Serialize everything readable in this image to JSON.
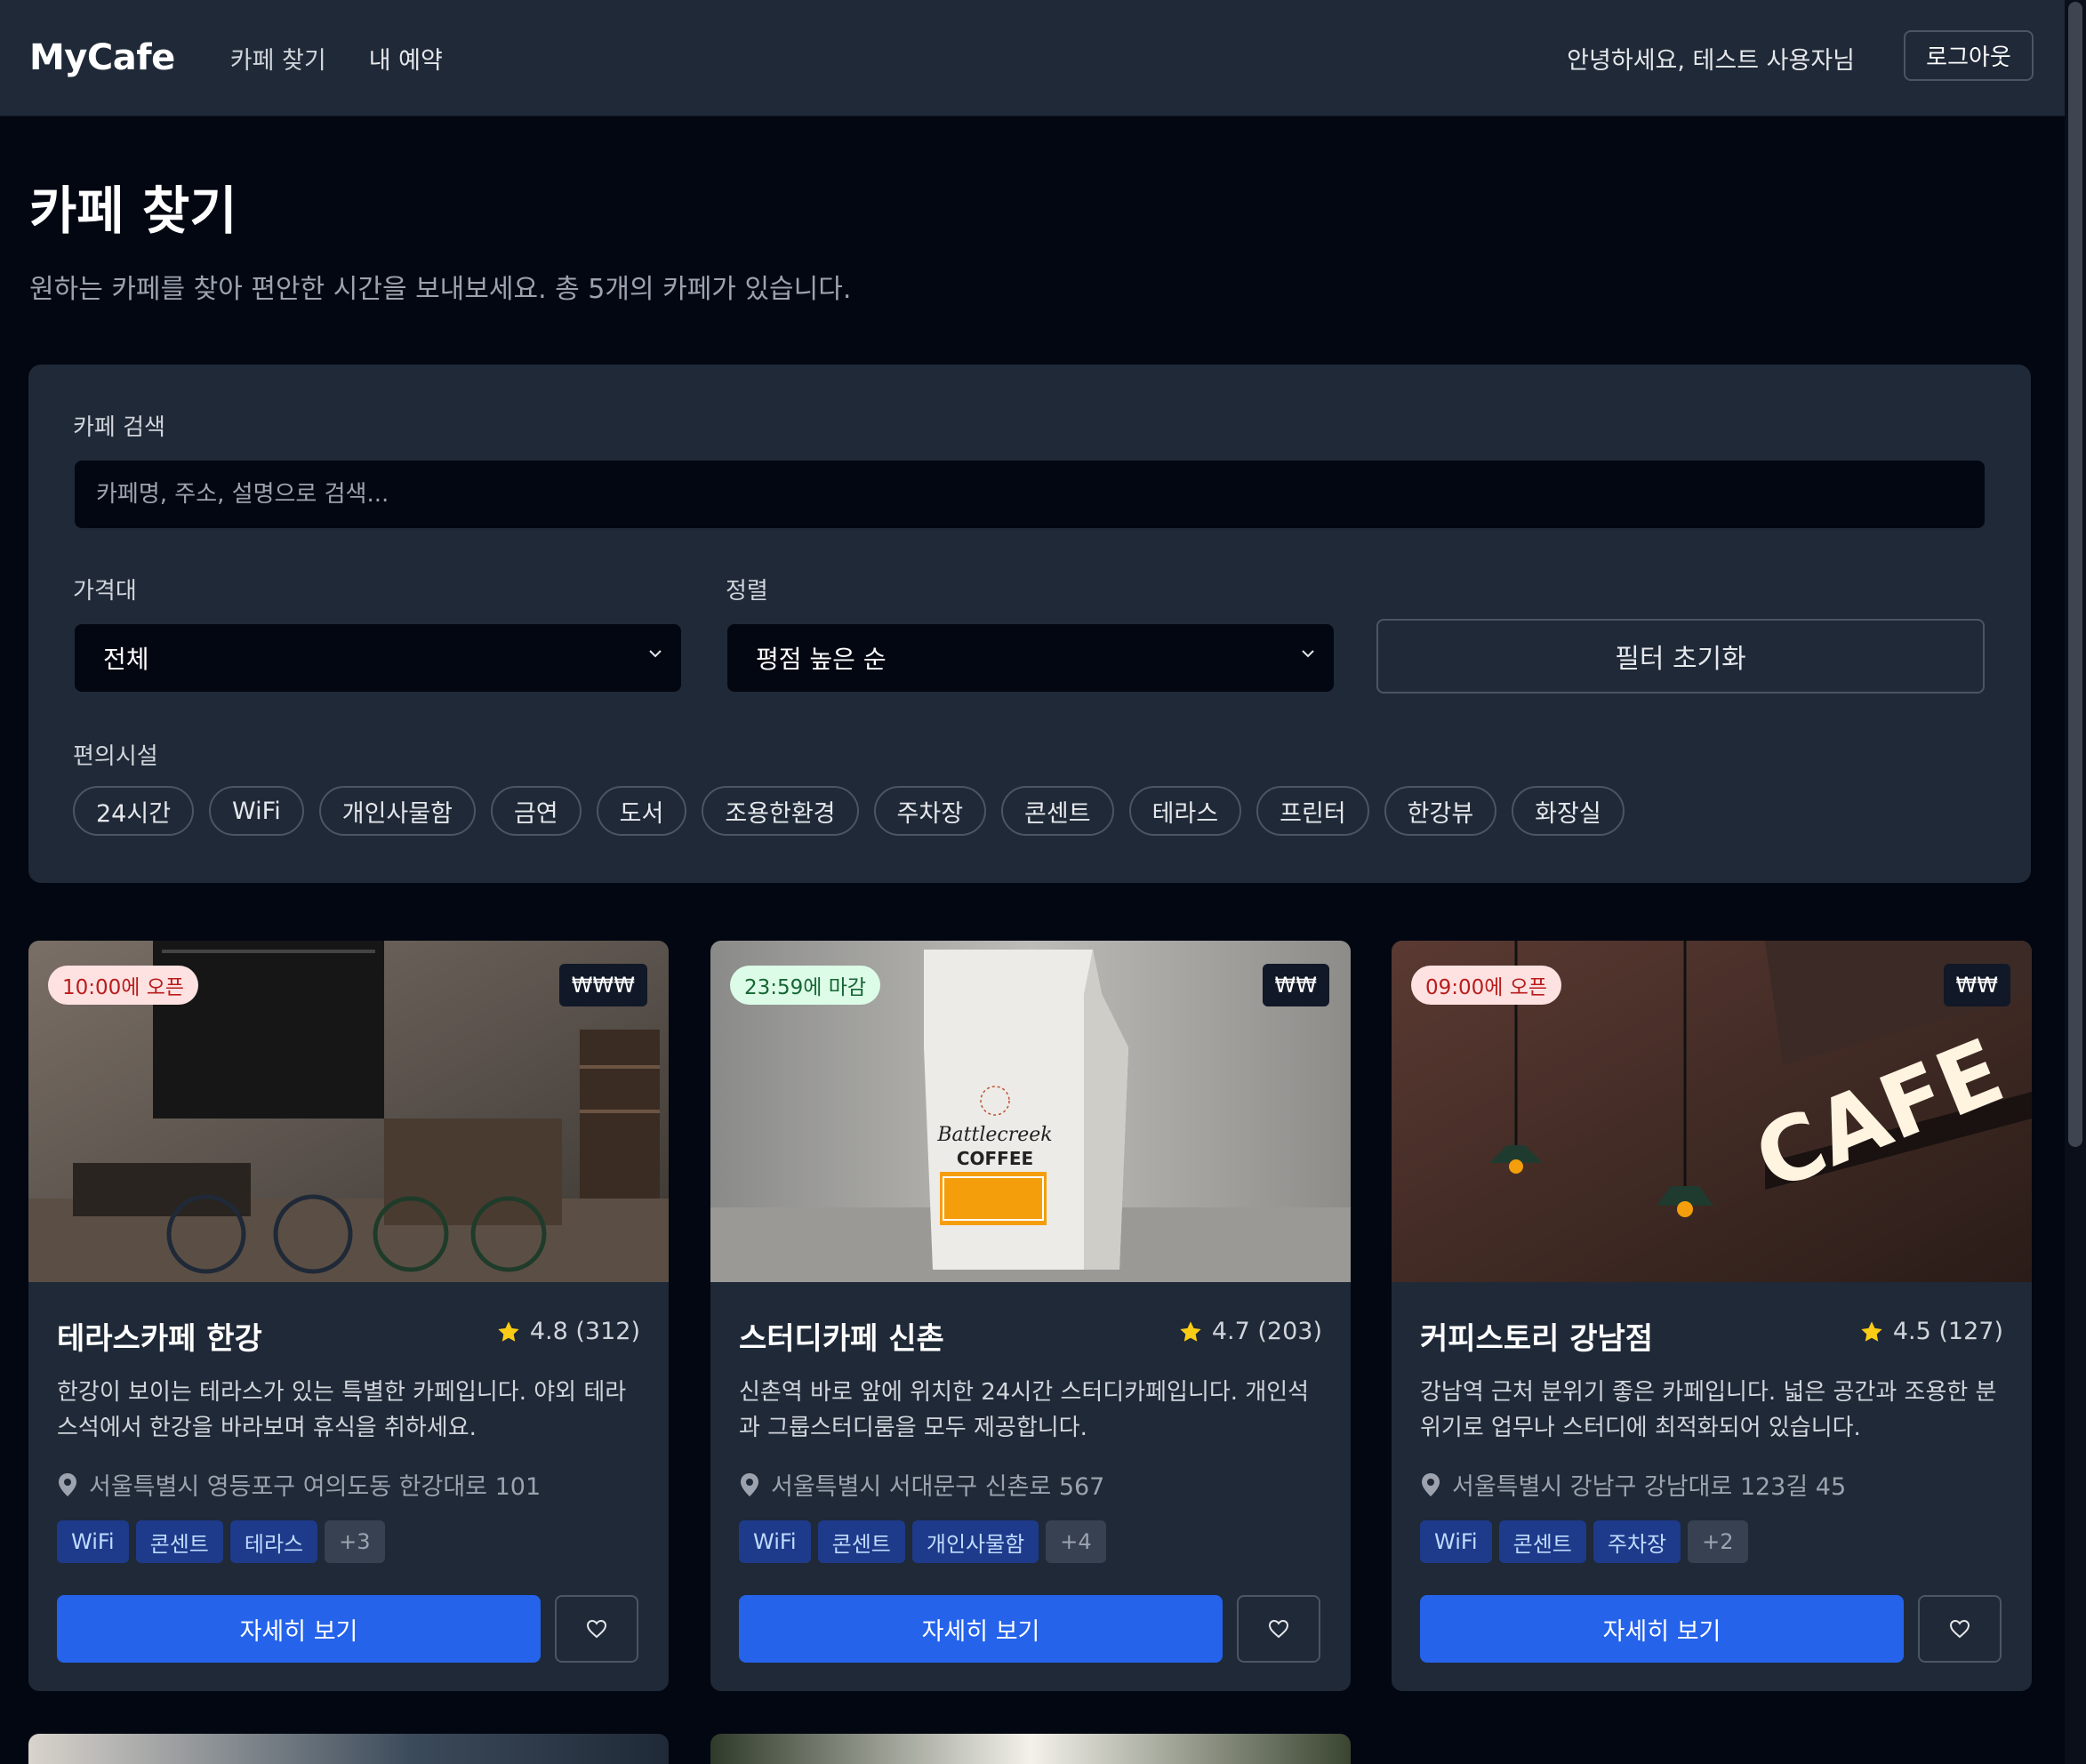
{
  "header": {
    "logo": "MyCafe",
    "nav": [
      "카페 찾기",
      "내 예약"
    ],
    "greeting": "안녕하세요, 테스트 사용자님",
    "logout_label": "로그아웃"
  },
  "page": {
    "title": "카페 찾기",
    "subtitle": "원하는 카페를 찾아 편안한 시간을 보내보세요. 총 5개의 카페가 있습니다."
  },
  "filters": {
    "search_label": "카페 검색",
    "search_placeholder": "카페명, 주소, 설명으로 검색...",
    "price_label": "가격대",
    "price_value": "전체",
    "sort_label": "정렬",
    "sort_value": "평점 높은 순",
    "reset_label": "필터 초기화",
    "amenities_label": "편의시설",
    "amenities": [
      "24시간",
      "WiFi",
      "개인사물함",
      "금연",
      "도서",
      "조용한환경",
      "주차장",
      "콘센트",
      "테라스",
      "프린터",
      "한강뷰",
      "화장실"
    ]
  },
  "cafes": [
    {
      "status": "10:00에 오픈",
      "status_type": "open",
      "price": "₩₩₩",
      "name": "테라스카페 한강",
      "rating": "4.8 (312)",
      "description": "한강이 보이는 테라스가 있는 특별한 카페입니다. 야외 테라스석에서 한강을 바라보며 휴식을 취하세요.",
      "address": "서울특별시 영등포구 여의도동 한강대로 101",
      "tags": [
        "WiFi",
        "콘센트",
        "테라스"
      ],
      "more": "+3",
      "detail_label": "자세히 보기"
    },
    {
      "status": "23:59에 마감",
      "status_type": "close",
      "price": "₩₩",
      "name": "스터디카페 신촌",
      "rating": "4.7 (203)",
      "description": "신촌역 바로 앞에 위치한 24시간 스터디카페입니다. 개인석과 그룹스터디룸을 모두 제공합니다.",
      "address": "서울특별시 서대문구 신촌로 567",
      "tags": [
        "WiFi",
        "콘센트",
        "개인사물함"
      ],
      "more": "+4",
      "detail_label": "자세히 보기"
    },
    {
      "status": "09:00에 오픈",
      "status_type": "open",
      "price": "₩₩",
      "name": "커피스토리 강남점",
      "rating": "4.5 (127)",
      "description": "강남역 근처 분위기 좋은 카페입니다. 넓은 공간과 조용한 분위기로 업무나 스터디에 최적화되어 있습니다.",
      "address": "서울특별시 강남구 강남대로 123길 45",
      "tags": [
        "WiFi",
        "콘센트",
        "주차장"
      ],
      "more": "+2",
      "detail_label": "자세히 보기"
    }
  ],
  "colors": {
    "bg": "#030712",
    "panel": "#1f2937",
    "accent": "#2563eb",
    "star": "#facc15"
  }
}
